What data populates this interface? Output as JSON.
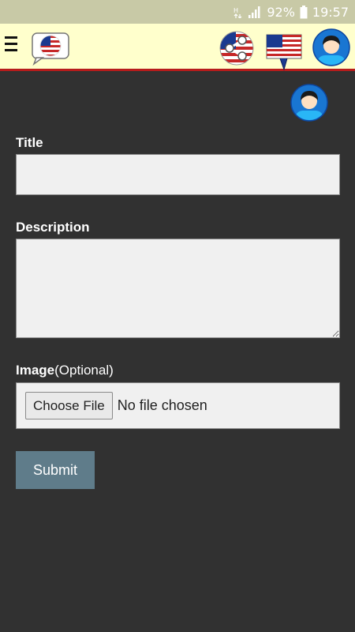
{
  "status_bar": {
    "battery_percent": "92%",
    "time": "19:57",
    "icons": [
      "data-icon",
      "signal-icon",
      "battery-icon"
    ]
  },
  "header": {
    "icons": [
      "menu-icon",
      "us-flag-speech-bubble-icon",
      "share-icon",
      "us-flag-pin-icon",
      "avatar-icon"
    ]
  },
  "form": {
    "title_label": "Title",
    "title_value": "",
    "description_label": "Description",
    "description_value": "",
    "image_label": "Image",
    "image_optional": "(Optional)",
    "choose_file_label": "Choose File",
    "file_status": "No file chosen",
    "submit_label": "Submit"
  },
  "colors": {
    "status_bar": "#c8c9a6",
    "app_bar": "#ffffcc",
    "app_bar_border": "#b71c1c",
    "background": "#313131",
    "input_bg": "#f0f0f0",
    "submit_bg": "#5f7c8a"
  }
}
